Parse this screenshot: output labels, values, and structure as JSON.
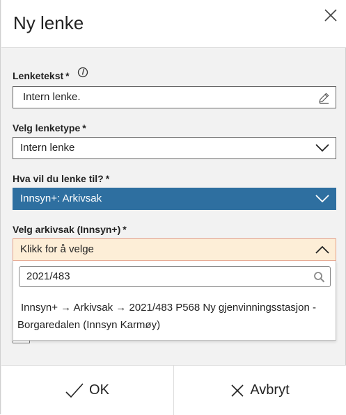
{
  "dialog": {
    "title": "Ny lenke"
  },
  "fields": {
    "link_text": {
      "label": "Lenketekst",
      "required_mark": "*",
      "value": "Intern lenke."
    },
    "link_type": {
      "label": "Velg lenketype",
      "required_mark": "*",
      "value": "Intern lenke"
    },
    "link_target": {
      "label": "Hva vil du lenke til?",
      "required_mark": "*",
      "value": "Innsyn+: Arkivsak"
    },
    "archive_case": {
      "label": "Velg arkivsak (Innsyn+)",
      "required_mark": "*",
      "value": "Klikk for å velge"
    }
  },
  "dropdown": {
    "search_value": "2021/483",
    "options": [
      {
        "line1": "Innsyn+ → Arkivsak → 2021/483 P568 Ny gjenvinningsstasjon -",
        "line2": "Borgaredalen (Innsyn Karmøy)"
      }
    ]
  },
  "footer": {
    "ok_label": "OK",
    "cancel_label": "Avbryt"
  },
  "colors": {
    "selected_blue": "#2e6fa0",
    "active_field_bg": "#fdeed7",
    "active_field_border": "#e6a187"
  },
  "icons": {
    "close": "close-icon",
    "info": "info-icon",
    "edit": "pencil-icon",
    "chevron_down": "chevron-down-icon",
    "chevron_up": "chevron-up-icon",
    "search": "search-icon",
    "check": "check-icon",
    "cancel": "x-icon"
  }
}
